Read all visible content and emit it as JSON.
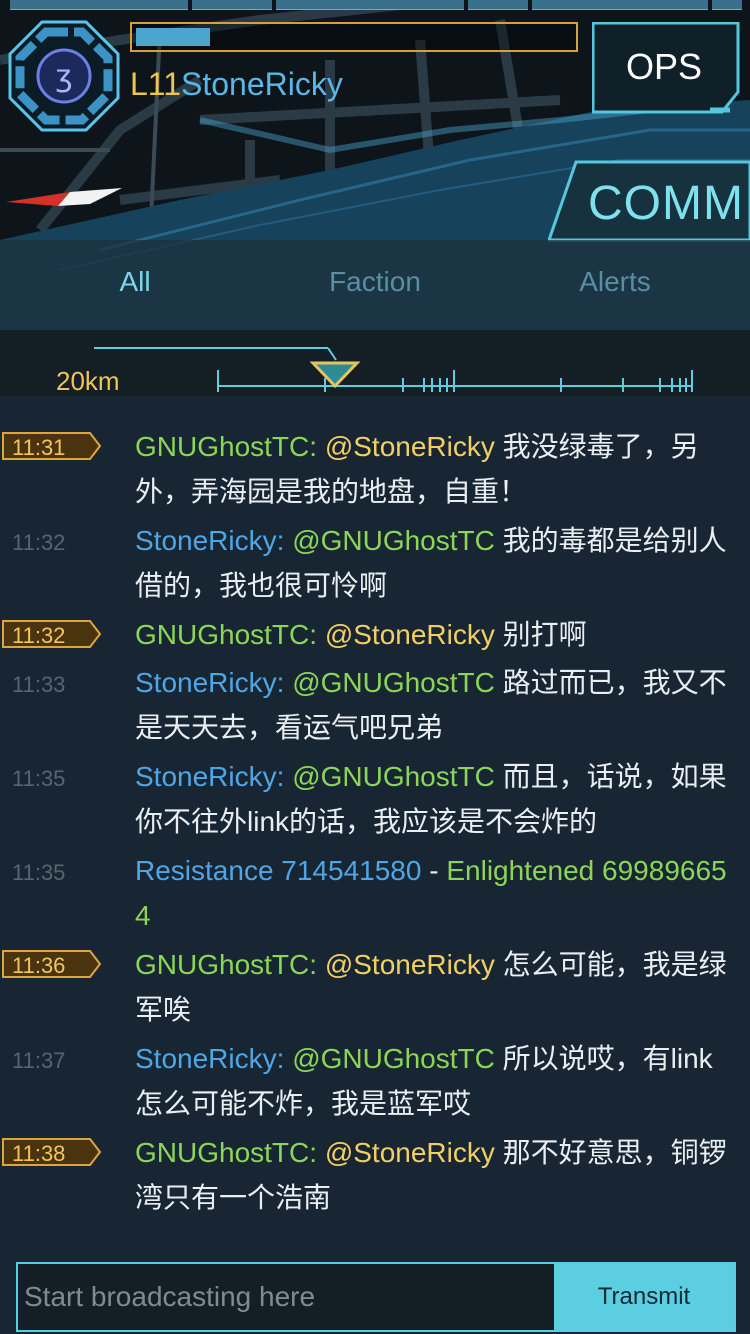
{
  "header": {
    "level": "L11",
    "agent_name": "StoneRicky",
    "xp_progress": 0.17,
    "ops_label": "OPS",
    "comm_label": "COMM"
  },
  "tabs": [
    {
      "label": "All",
      "active": true
    },
    {
      "label": "Faction",
      "active": false
    },
    {
      "label": "Alerts",
      "active": false
    }
  ],
  "range": {
    "label": "20km"
  },
  "colors": {
    "enlightened": "#8bd657",
    "resistance": "#4fa6e6",
    "mention_yellow": "#f2cf63",
    "accent": "#57cfe0",
    "timestamp_highlight": "#f4c65a"
  },
  "messages": [
    {
      "time": "11:31",
      "highlight": true,
      "sender": "GNUGhostTC:",
      "sender_faction": "enlightened",
      "mention": "@StoneRicky",
      "mention_color": "yellow",
      "text": " 我没绿毒了，另外，弄海园是我的地盘，自重！"
    },
    {
      "time": "11:32",
      "highlight": false,
      "sender": "StoneRicky:",
      "sender_faction": "resistance",
      "mention": "@GNUGhostTC",
      "mention_color": "green",
      "text": " 我的毒都是给别人借的，我也很可怜啊"
    },
    {
      "time": "11:32",
      "highlight": true,
      "sender": "GNUGhostTC:",
      "sender_faction": "enlightened",
      "mention": "@StoneRicky",
      "mention_color": "yellow",
      "text": " 别打啊"
    },
    {
      "time": "11:33",
      "highlight": false,
      "sender": "StoneRicky:",
      "sender_faction": "resistance",
      "mention": "@GNUGhostTC",
      "mention_color": "green",
      "text": " 路过而已，我又不是天天去，看运气吧兄弟"
    },
    {
      "time": "11:35",
      "highlight": false,
      "sender": "StoneRicky:",
      "sender_faction": "resistance",
      "mention": "@GNUGhostTC",
      "mention_color": "green",
      "text": " 而且，话说，如果你不往外link的话，我应该是不会炸的"
    },
    {
      "time": "11:35",
      "highlight": false,
      "system": true,
      "part1": "Resistance 714541580",
      "sep": " - ",
      "part2": "Enlightened 699896654"
    },
    {
      "time": "11:36",
      "highlight": true,
      "sender": "GNUGhostTC:",
      "sender_faction": "enlightened",
      "mention": "@StoneRicky",
      "mention_color": "yellow",
      "text": " 怎么可能，我是绿军唉"
    },
    {
      "time": "11:37",
      "highlight": false,
      "sender": "StoneRicky:",
      "sender_faction": "resistance",
      "mention": "@GNUGhostTC",
      "mention_color": "green",
      "text": " 所以说哎，有link怎么可能不炸，我是蓝军哎"
    },
    {
      "time": "11:38",
      "highlight": true,
      "sender": "GNUGhostTC:",
      "sender_faction": "enlightened",
      "mention": "@StoneRicky",
      "mention_color": "yellow",
      "text": " 那不好意思，铜锣湾只有一个浩南"
    }
  ],
  "input": {
    "placeholder": "Start broadcasting here",
    "value": "",
    "transmit_label": "Transmit"
  }
}
